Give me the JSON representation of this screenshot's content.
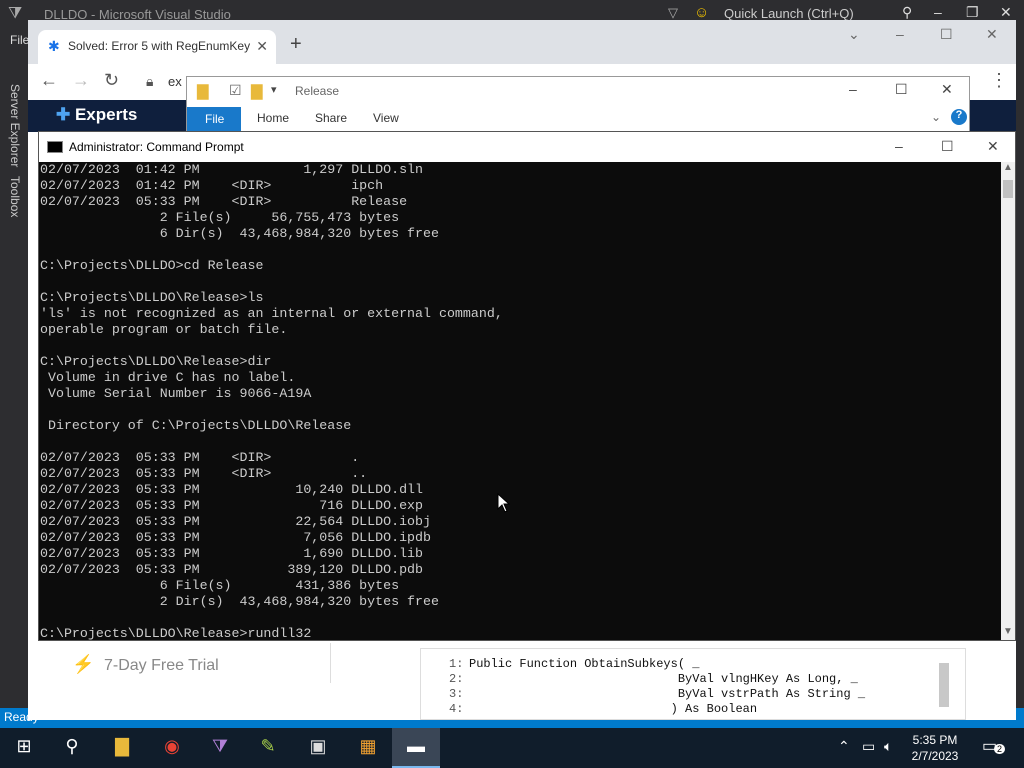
{
  "vs": {
    "title": "DLLDO - Microsoft Visual Studio",
    "quick_launch": "Quick Launch (Ctrl+Q)",
    "menu_file": "File",
    "side_tabs": [
      "Server Explorer",
      "Toolbox"
    ],
    "status": "Ready"
  },
  "chrome": {
    "tab_title": "Solved: Error 5 with RegEnumKey",
    "address_partial": "ex",
    "site_logo": "Experts",
    "trial": "7-Day Free Trial",
    "code_lines": [
      {
        "num": "1:",
        "text": "Public Function ObtainSubkeys( _"
      },
      {
        "num": "2:",
        "text": "                             ByVal vlngHKey As Long, _"
      },
      {
        "num": "3:",
        "text": "                             ByVal vstrPath As String _"
      },
      {
        "num": "4:",
        "text": "                            ) As Boolean"
      }
    ]
  },
  "explorer": {
    "path": "Release",
    "tabs": {
      "file": "File",
      "home": "Home",
      "share": "Share",
      "view": "View"
    }
  },
  "cmd": {
    "title": "Administrator: Command Prompt",
    "lines": [
      "02/07/2023  01:42 PM             1,297 DLLDO.sln",
      "02/07/2023  01:42 PM    <DIR>          ipch",
      "02/07/2023  05:33 PM    <DIR>          Release",
      "               2 File(s)     56,755,473 bytes",
      "               6 Dir(s)  43,468,984,320 bytes free",
      "",
      "C:\\Projects\\DLLDO>cd Release",
      "",
      "C:\\Projects\\DLLDO\\Release>ls",
      "'ls' is not recognized as an internal or external command,",
      "operable program or batch file.",
      "",
      "C:\\Projects\\DLLDO\\Release>dir",
      " Volume in drive C has no label.",
      " Volume Serial Number is 9066-A19A",
      "",
      " Directory of C:\\Projects\\DLLDO\\Release",
      "",
      "02/07/2023  05:33 PM    <DIR>          .",
      "02/07/2023  05:33 PM    <DIR>          ..",
      "02/07/2023  05:33 PM            10,240 DLLDO.dll",
      "02/07/2023  05:33 PM               716 DLLDO.exp",
      "02/07/2023  05:33 PM            22,564 DLLDO.iobj",
      "02/07/2023  05:33 PM             7,056 DLLDO.ipdb",
      "02/07/2023  05:33 PM             1,690 DLLDO.lib",
      "02/07/2023  05:33 PM           389,120 DLLDO.pdb",
      "               6 File(s)        431,386 bytes",
      "               2 Dir(s)  43,468,984,320 bytes free",
      "",
      "C:\\Projects\\DLLDO\\Release>rundll32"
    ]
  },
  "taskbar": {
    "time": "5:35 PM",
    "date": "2/7/2023",
    "notif_count": "2"
  }
}
